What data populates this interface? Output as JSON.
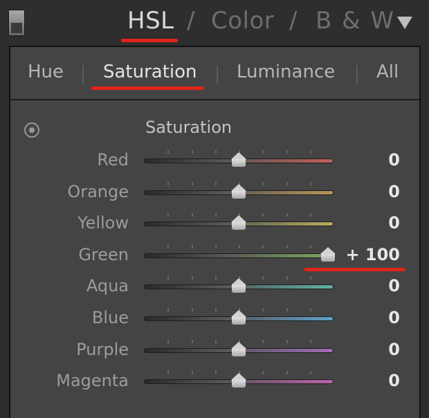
{
  "header": {
    "tabs": [
      {
        "label": "HSL"
      },
      {
        "label": "Color"
      },
      {
        "label": "B & W"
      }
    ],
    "separator": "/"
  },
  "subtabs": [
    {
      "label": "Hue"
    },
    {
      "label": "Saturation"
    },
    {
      "label": "Luminance"
    },
    {
      "label": "All"
    }
  ],
  "section": {
    "title": "Saturation"
  },
  "sliders": [
    {
      "label": "Red",
      "value": "0",
      "level": 0
    },
    {
      "label": "Orange",
      "value": "0",
      "level": 0
    },
    {
      "label": "Yellow",
      "value": "0",
      "level": 0
    },
    {
      "label": "Green",
      "value": "+ 100",
      "level": 100
    },
    {
      "label": "Aqua",
      "value": "0",
      "level": 0
    },
    {
      "label": "Blue",
      "value": "0",
      "level": 0
    },
    {
      "label": "Purple",
      "value": "0",
      "level": 0
    },
    {
      "label": "Magenta",
      "value": "0",
      "level": 0
    }
  ],
  "colors": {
    "annotation": "#e0241b",
    "Red": "#c0605a",
    "Orange": "#b8955a",
    "Yellow": "#b3ac5c",
    "Green": "#7ea760",
    "Aqua": "#5fb1a9",
    "Blue": "#5f9fc9",
    "Purple": "#a06cb8",
    "Magenta": "#ba62a8"
  }
}
